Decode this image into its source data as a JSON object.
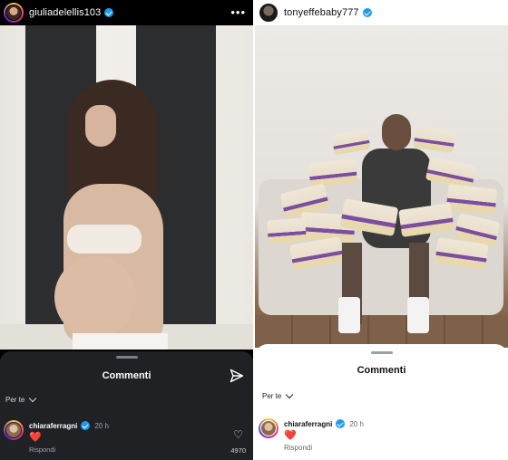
{
  "left_post": {
    "username": "giuliadelellis103",
    "more_icon": "more-horizontal-icon",
    "comments": {
      "title": "Commenti",
      "send_icon": "send-icon",
      "sort_label": "Per te",
      "comment": {
        "username": "chiaraferragni",
        "time": "20 h",
        "text": "❤️",
        "reply_label": "Rispondi",
        "like_count": "4970"
      }
    }
  },
  "right_post": {
    "username": "tonyeffebaby777",
    "comments": {
      "title": "Commenti",
      "sort_label": "Per te",
      "comment": {
        "username": "chiaraferragni",
        "time": "20 h",
        "text": "❤️",
        "reply_label": "Rispondi"
      }
    }
  },
  "colors": {
    "verified_badge": "#1d9bf0",
    "heart": "#e0245e",
    "dark_sheet": "#1f2125"
  }
}
